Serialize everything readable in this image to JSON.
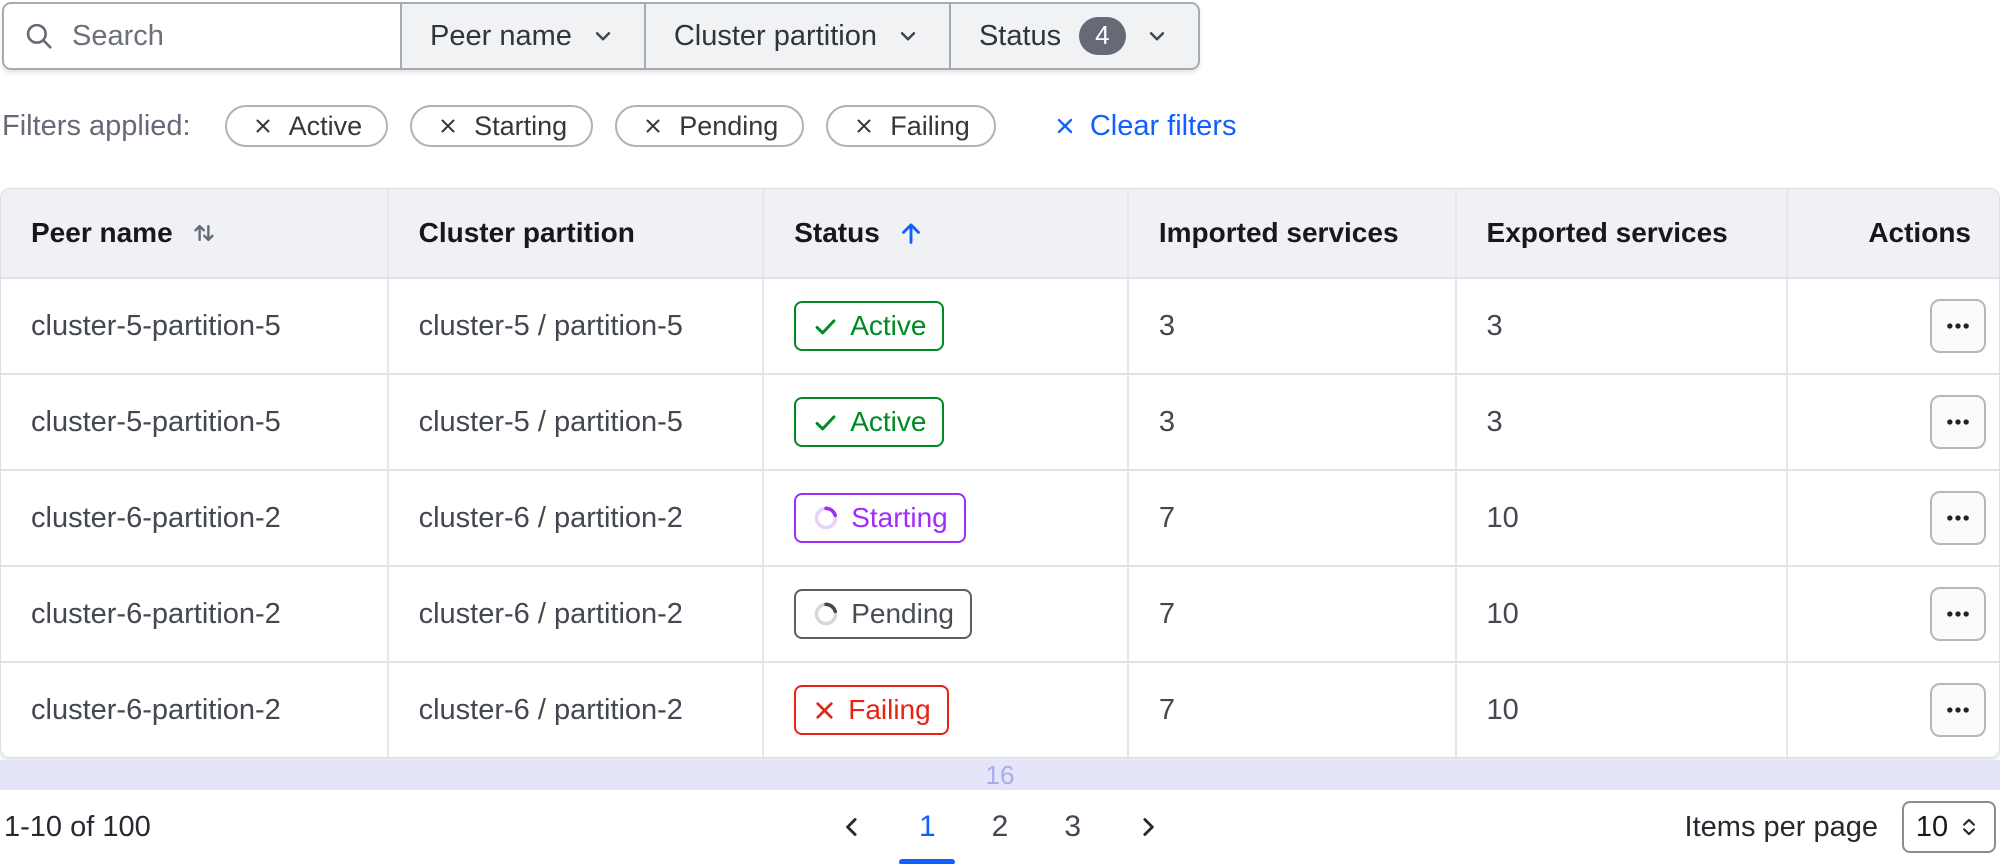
{
  "toolbar": {
    "search": {
      "placeholder": "Search"
    },
    "dropdowns": [
      {
        "label": "Peer name"
      },
      {
        "label": "Cluster partition"
      },
      {
        "label": "Status",
        "badge": "4"
      }
    ]
  },
  "filters_applied": {
    "label": "Filters applied:",
    "chips": [
      {
        "label": "Active"
      },
      {
        "label": "Starting"
      },
      {
        "label": "Pending"
      },
      {
        "label": "Failing"
      }
    ],
    "clear_label": "Clear filters"
  },
  "table": {
    "columns": [
      {
        "label": "Peer name",
        "sort": "both"
      },
      {
        "label": "Cluster partition"
      },
      {
        "label": "Status",
        "sort": "ascending"
      },
      {
        "label": "Imported services"
      },
      {
        "label": "Exported services"
      },
      {
        "label": "Actions"
      }
    ],
    "rows": [
      {
        "peer_name": "cluster-5-partition-5",
        "cluster_partition": "cluster-5 / partition-5",
        "status": "Active",
        "imported_services": "3",
        "exported_services": "3"
      },
      {
        "peer_name": "cluster-5-partition-5",
        "cluster_partition": "cluster-5 / partition-5",
        "status": "Active",
        "imported_services": "3",
        "exported_services": "3"
      },
      {
        "peer_name": "cluster-6-partition-2",
        "cluster_partition": "cluster-6 / partition-2",
        "status": "Starting",
        "imported_services": "7",
        "exported_services": "10"
      },
      {
        "peer_name": "cluster-6-partition-2",
        "cluster_partition": "cluster-6 / partition-2",
        "status": "Pending",
        "imported_services": "7",
        "exported_services": "10"
      },
      {
        "peer_name": "cluster-6-partition-2",
        "cluster_partition": "cluster-6 / partition-2",
        "status": "Failing",
        "imported_services": "7",
        "exported_services": "10"
      }
    ]
  },
  "scroll_indicator": {
    "value": "16"
  },
  "footer": {
    "range_label": "1-10 of 100",
    "pages": [
      "1",
      "2",
      "3"
    ],
    "current_page": "1",
    "items_per_page_label": "Items per page",
    "items_per_page_value": "10"
  },
  "colors": {
    "accent_blue": "#1060ff",
    "status_active_green": "#008a22",
    "status_starting_purple": "#a12bf8",
    "status_pending_gray": "#53575f",
    "status_failing_red": "#e8230e",
    "count_badge_bg": "#656a76",
    "table_header_bg": "#f0f1f5",
    "scroll_strip_bg": "#e5e5f9"
  }
}
